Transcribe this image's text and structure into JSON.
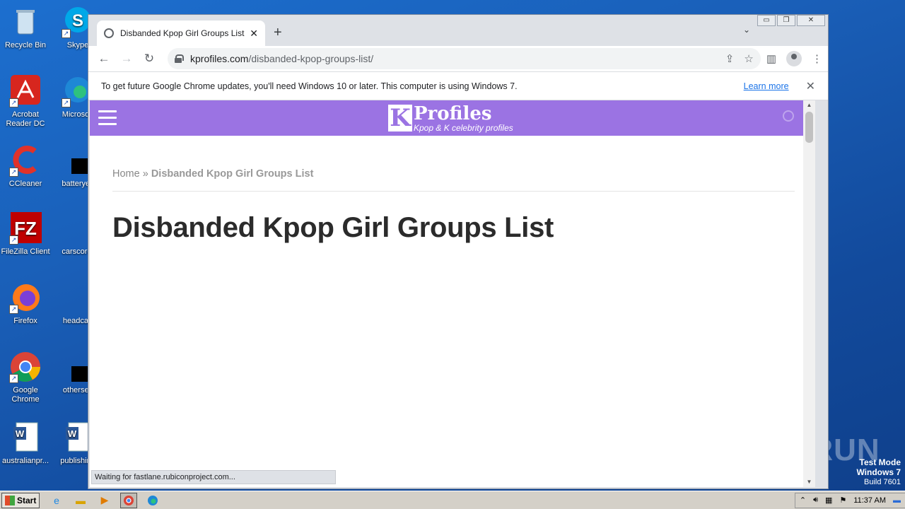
{
  "desktop": {
    "icons": [
      {
        "label": "Recycle Bin"
      },
      {
        "label": "Skype"
      },
      {
        "label": "Acrobat Reader DC"
      },
      {
        "label": "Microsoft"
      },
      {
        "label": "CCleaner"
      },
      {
        "label": "batteryey"
      },
      {
        "label": "FileZilla Client"
      },
      {
        "label": "carscore."
      },
      {
        "label": "Firefox"
      },
      {
        "label": "headcar."
      },
      {
        "label": "Google Chrome"
      },
      {
        "label": "othersev"
      },
      {
        "label": "australianpr..."
      },
      {
        "label": "publishing"
      }
    ],
    "watermark": "ANY RUN",
    "test_mode": {
      "line1": "Test Mode",
      "line2": "Windows 7",
      "line3": "Build 7601"
    }
  },
  "browser": {
    "window_controls": {
      "minimize": "▭",
      "restore": "❐",
      "close": "✕"
    },
    "tab": {
      "title": "Disbanded Kpop Girl Groups List - Kp",
      "close": "✕"
    },
    "new_tab": "+",
    "tab_menu": "⌄",
    "nav": {
      "back": "←",
      "forward": "→",
      "reload": "↻"
    },
    "url": {
      "host": "kprofiles.com",
      "path": "/disbanded-kpop-groups-list/"
    },
    "infobar": {
      "message": "To get future Google Chrome updates, you'll need Windows 10 or later. This computer is using Windows 7.",
      "link": "Learn more",
      "close": "✕"
    },
    "status": "Waiting for fastlane.rubiconproject.com..."
  },
  "page": {
    "logo": {
      "letter": "K",
      "name": "Profiles",
      "tagline": "Kpop & K celebrity profiles"
    },
    "breadcrumb": {
      "home": "Home",
      "separator": " » ",
      "current": "Disbanded Kpop Girl Groups List"
    },
    "title": "Disbanded Kpop Girl Groups List",
    "colors": {
      "header": "#9b73e3"
    }
  },
  "taskbar": {
    "start": "Start",
    "clock": "11:37 AM"
  }
}
